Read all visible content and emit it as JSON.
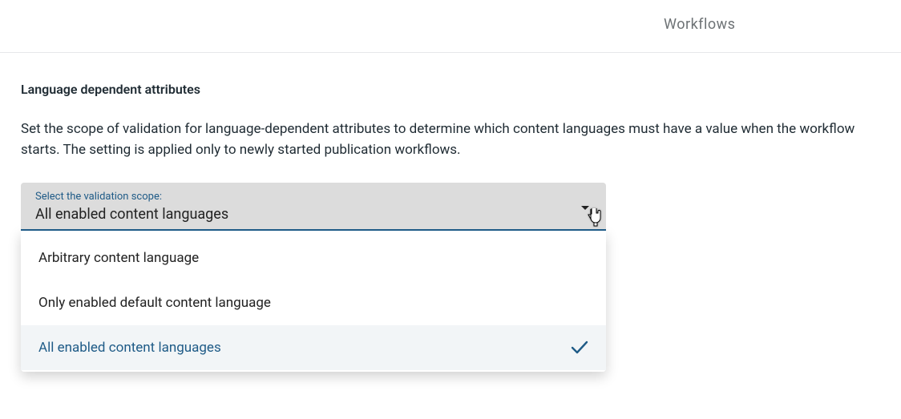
{
  "tab": {
    "label": "Workflows"
  },
  "section": {
    "title": "Language dependent attributes",
    "description": "Set the scope of validation for language-dependent attributes to determine which content languages must have a value when the workflow starts. The setting is applied only to newly started publication workflows."
  },
  "select": {
    "label": "Select the validation scope:",
    "value": "All enabled content languages",
    "options": [
      {
        "label": "Arbitrary content language",
        "selected": false
      },
      {
        "label": "Only enabled default content language",
        "selected": false
      },
      {
        "label": "All enabled content languages",
        "selected": true
      }
    ]
  },
  "colors": {
    "accent": "#1f5b87"
  }
}
